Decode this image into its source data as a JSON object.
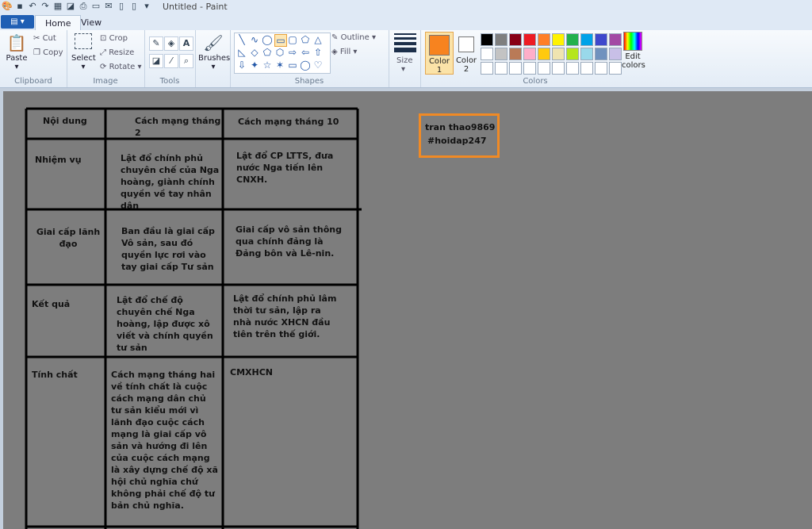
{
  "titlebar": {
    "title": "Untitled - Paint",
    "qat_icons": [
      "paint-app-icon",
      "save-icon",
      "undo-icon",
      "redo-icon",
      "color-picker-icon",
      "eraser-icon",
      "print-icon",
      "print-preview-icon",
      "email-icon",
      "new-icon",
      "open-icon",
      "dropdown-icon"
    ]
  },
  "tabs": {
    "file": "",
    "home": "Home",
    "view": "View"
  },
  "ribbon": {
    "clipboard": {
      "label": "Clipboard",
      "paste": "Paste",
      "cut": "Cut",
      "copy": "Copy"
    },
    "image": {
      "label": "Image",
      "select": "Select",
      "crop": "Crop",
      "resize": "Resize",
      "rotate": "Rotate"
    },
    "tools": {
      "label": "Tools"
    },
    "brushes": {
      "label": "Brushes"
    },
    "shapes": {
      "label": "Shapes",
      "outline": "Outline",
      "fill": "Fill"
    },
    "size": {
      "label": "Size"
    },
    "colors": {
      "label": "Colors",
      "color1": "Color",
      "color1_num": "1",
      "color2": "Color",
      "color2_num": "2",
      "color1_value": "#f7831f",
      "color2_value": "#ffffff",
      "edit": "Edit",
      "edit2": "colors",
      "palette_row1": [
        "#000000",
        "#7f7f7f",
        "#880015",
        "#ed1c24",
        "#ff7f27",
        "#fff200",
        "#22b14c",
        "#00a2e8",
        "#3f48cc",
        "#a349a4"
      ],
      "palette_row2": [
        "#ffffff",
        "#c3c3c3",
        "#b97a57",
        "#ffaec9",
        "#ffc90e",
        "#efe4b0",
        "#b5e61d",
        "#99d9ea",
        "#7092be",
        "#c8bfe7"
      ]
    }
  },
  "canvas": {
    "note_line1": "tran thao9869",
    "note_line2": "#hoidap247",
    "table": {
      "headers": [
        "Nội dung",
        "Cách mạng tháng 2",
        "Cách mạng tháng 10"
      ],
      "rows": [
        [
          "Nhiệm vụ",
          "Lật đổ chính phủ chuyên chế của Nga hoàng, giành chính quyền về tay nhân dân",
          "Lật đổ CP LTTS, đưa nước Nga tiến lên CNXH."
        ],
        [
          "Giai cấp lãnh đạo",
          "Ban đầu là giai cấp Vô sản, sau đó quyền lực rơi vào tay giai cấp Tư sản",
          "Giai cấp vô sản thông qua chính đảng là Đảng bôn và Lê-nin."
        ],
        [
          "Kết quả",
          "Lật đổ chế độ chuyên chế Nga hoàng, lập được xô viết và chính quyền tư sản",
          "Lật đổ chính phủ lâm thời tư sản, lập ra nhà nước XHCN đầu tiên trên thế giới."
        ],
        [
          "Tính chất",
          "Cách mạng tháng hai về tính chất là cuộc cách mạng dân chủ tư sản kiểu mới vì lãnh đạo cuộc cách mạng là giai cấp vô sản và hướng đi lên của cuộc cách mạng là xây dựng chế độ xã hội chủ nghĩa chứ không phải chế độ tư bản chủ nghĩa.",
          "CMXHCN"
        ]
      ]
    }
  }
}
